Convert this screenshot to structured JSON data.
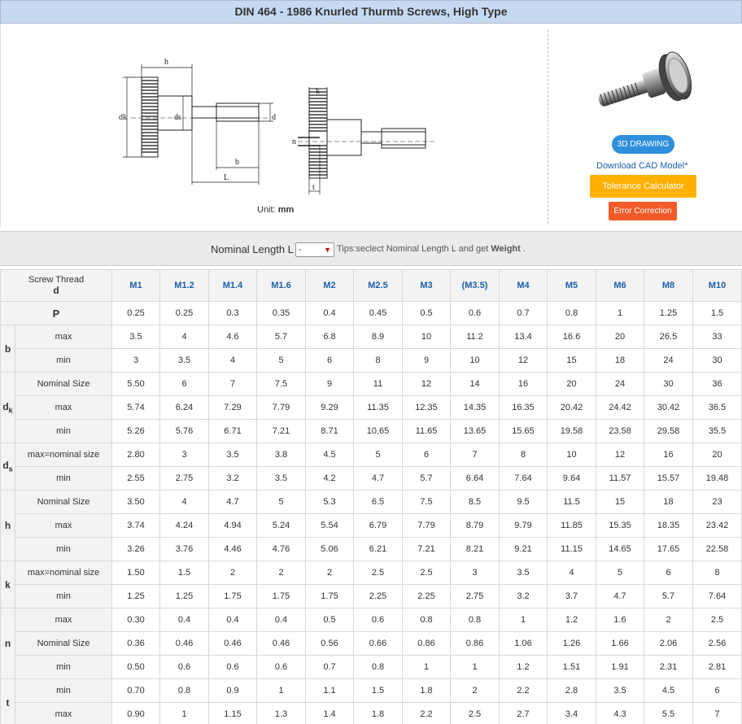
{
  "title": "DIN 464 - 1986 Knurled Thurmb Screws, High Type",
  "diagram": {
    "labels": {
      "h": "h",
      "k": "k",
      "dk": "dk",
      "ds": "ds",
      "d": "d",
      "b": "b",
      "L": "L",
      "n": "n",
      "t": "t"
    },
    "unit_prefix": "Unit:",
    "unit": "mm"
  },
  "product": {
    "drawing_button": "3D DRAWING",
    "cad_link": "Download CAD Model*",
    "tolerance_button": "Tolerance Calculator",
    "error_button": "Error Correction"
  },
  "filter": {
    "label": "Nominal Length L",
    "selected": "-",
    "tips_prefix": "Tips:seclect Nominal Length L and get",
    "tips_bold": "Weight",
    "tips_suffix": "."
  },
  "table": {
    "header_top": "Screw Thread",
    "header_sub": "d",
    "columns": [
      "M1",
      "M1.2",
      "M1.4",
      "M1.6",
      "M2",
      "M2.5",
      "M3",
      "(M3.5)",
      "M4",
      "M5",
      "M6",
      "M8",
      "M10"
    ],
    "rows": {
      "P": {
        "label": "P",
        "values": [
          "0.25",
          "0.25",
          "0.3",
          "0.35",
          "0.4",
          "0.45",
          "0.5",
          "0.6",
          "0.7",
          "0.8",
          "1",
          "1.25",
          "1.5"
        ]
      },
      "b_max": {
        "label": "max",
        "values": [
          "3.5",
          "4",
          "4.6",
          "5.7",
          "6.8",
          "8.9",
          "10",
          "11.2",
          "13.4",
          "16.6",
          "20",
          "26.5",
          "33"
        ]
      },
      "b_min": {
        "label": "min",
        "values": [
          "3",
          "3.5",
          "4",
          "5",
          "6",
          "8",
          "9",
          "10",
          "12",
          "15",
          "18",
          "24",
          "30"
        ]
      },
      "dk_nom": {
        "label": "Nominal Size",
        "values": [
          "5.50",
          "6",
          "7",
          "7.5",
          "9",
          "11",
          "12",
          "14",
          "16",
          "20",
          "24",
          "30",
          "36"
        ]
      },
      "dk_max": {
        "label": "max",
        "values": [
          "5.74",
          "6.24",
          "7.29",
          "7.79",
          "9.29",
          "11.35",
          "12.35",
          "14.35",
          "16.35",
          "20.42",
          "24.42",
          "30.42",
          "36.5"
        ]
      },
      "dk_min": {
        "label": "min",
        "values": [
          "5.26",
          "5.76",
          "6.71",
          "7.21",
          "8.71",
          "10.65",
          "11.65",
          "13.65",
          "15.65",
          "19.58",
          "23.58",
          "29.58",
          "35.5"
        ]
      },
      "ds_max": {
        "label": "max=nominal size",
        "values": [
          "2.80",
          "3",
          "3.5",
          "3.8",
          "4.5",
          "5",
          "6",
          "7",
          "8",
          "10",
          "12",
          "16",
          "20"
        ]
      },
      "ds_min": {
        "label": "min",
        "values": [
          "2.55",
          "2.75",
          "3.2",
          "3.5",
          "4.2",
          "4.7",
          "5.7",
          "6.64",
          "7.64",
          "9.64",
          "11.57",
          "15.57",
          "19.48"
        ]
      },
      "h_nom": {
        "label": "Nominal Size",
        "values": [
          "3.50",
          "4",
          "4.7",
          "5",
          "5.3",
          "6.5",
          "7.5",
          "8.5",
          "9.5",
          "11.5",
          "15",
          "18",
          "23"
        ]
      },
      "h_max": {
        "label": "max",
        "values": [
          "3.74",
          "4.24",
          "4.94",
          "5.24",
          "5.54",
          "6.79",
          "7.79",
          "8.79",
          "9.79",
          "11.85",
          "15.35",
          "18.35",
          "23.42"
        ]
      },
      "h_min": {
        "label": "min",
        "values": [
          "3.26",
          "3.76",
          "4.46",
          "4.76",
          "5.06",
          "6.21",
          "7.21",
          "8.21",
          "9.21",
          "11.15",
          "14.65",
          "17.65",
          "22.58"
        ]
      },
      "k_max": {
        "label": "max=nominal size",
        "values": [
          "1.50",
          "1.5",
          "2",
          "2",
          "2",
          "2.5",
          "2.5",
          "3",
          "3.5",
          "4",
          "5",
          "6",
          "8"
        ]
      },
      "k_min": {
        "label": "min",
        "values": [
          "1.25",
          "1.25",
          "1.75",
          "1.75",
          "1.75",
          "2.25",
          "2.25",
          "2.75",
          "3.2",
          "3.7",
          "4.7",
          "5.7",
          "7.64"
        ]
      },
      "n_max": {
        "label": "max",
        "values": [
          "0.30",
          "0.4",
          "0.4",
          "0.4",
          "0.5",
          "0.6",
          "0.8",
          "0.8",
          "1",
          "1.2",
          "1.6",
          "2",
          "2.5"
        ]
      },
      "n_nom": {
        "label": "Nominal Size",
        "values": [
          "0.36",
          "0.46",
          "0.46",
          "0.46",
          "0.56",
          "0.66",
          "0.86",
          "0.86",
          "1.06",
          "1.26",
          "1.66",
          "2.06",
          "2.56"
        ]
      },
      "n_min": {
        "label": "min",
        "values": [
          "0.50",
          "0.6",
          "0.6",
          "0.6",
          "0.7",
          "0.8",
          "1",
          "1",
          "1.2",
          "1.51",
          "1.91",
          "2.31",
          "2.81"
        ]
      },
      "t_min": {
        "label": "min",
        "values": [
          "0.70",
          "0.8",
          "0.9",
          "1",
          "1.1",
          "1.5",
          "1.8",
          "2",
          "2.2",
          "2.8",
          "3.5",
          "4.5",
          "6"
        ]
      },
      "t_max": {
        "label": "max",
        "values": [
          "0.90",
          "1",
          "1.15",
          "1.3",
          "1.4",
          "1.8",
          "2.2",
          "2.5",
          "2.7",
          "3.4",
          "4.3",
          "5.5",
          "7"
        ]
      }
    },
    "groups": {
      "b": "b",
      "dk_main": "d",
      "dk_sub": "k",
      "ds_main": "d",
      "ds_sub": "s",
      "h": "h",
      "k": "k",
      "n": "n",
      "t": "t"
    }
  }
}
